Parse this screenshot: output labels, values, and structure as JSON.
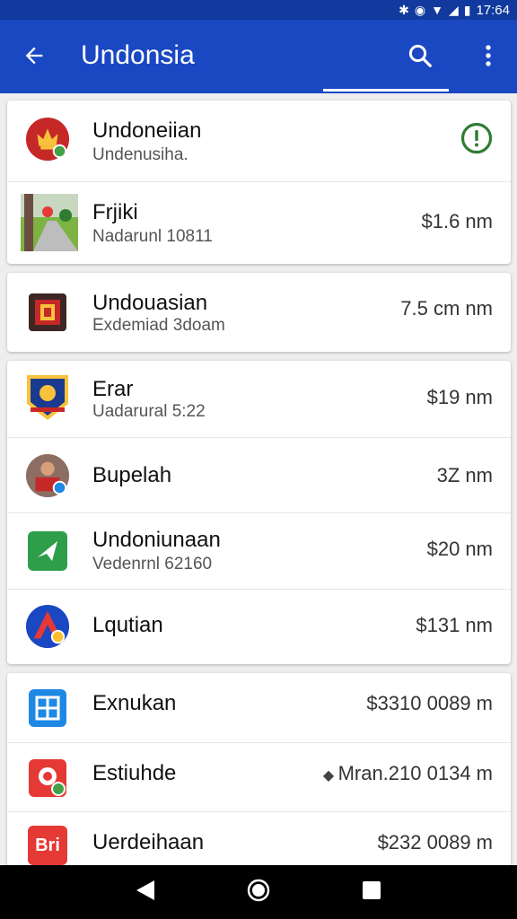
{
  "status_bar": {
    "time": "17:64",
    "colors": {
      "bg": "#123a9e"
    }
  },
  "app_bar": {
    "title": "Undonsia",
    "colors": {
      "bg": "#1a47c2"
    }
  },
  "card1": [
    {
      "name": "Undoneiian",
      "sub": "Undenusiha.",
      "amount": "",
      "icon": "emblem-icon",
      "status_icon": "alert-circle-icon"
    },
    {
      "name": "Frjiki",
      "sub": "Nadarunl 10811",
      "amount": "$1.6 nm",
      "icon": "photo-thumbnail-icon"
    }
  ],
  "card2": [
    {
      "name": "Undouasian",
      "sub": "Exdemiad 3doam",
      "amount": "7.5 cm nm",
      "icon": "crest-icon"
    }
  ],
  "card3": [
    {
      "name": "Erar",
      "sub": "Uadarural 5:22",
      "amount": "$19 nm",
      "icon": "badge-icon"
    },
    {
      "name": "Bupelah",
      "sub": "",
      "amount": "3Z nm",
      "icon": "avatar-icon"
    },
    {
      "name": "Undoniunaan",
      "sub": "Vedenrnl 62160",
      "amount": "$20 nm",
      "icon": "send-icon"
    },
    {
      "name": "Lqutian",
      "sub": "",
      "amount": "$131 nm",
      "icon": "a-logo-icon"
    }
  ],
  "card4": [
    {
      "name": "Exnukan",
      "sub": "",
      "amount": "$3310 0089 m",
      "icon": "grid-app-icon"
    },
    {
      "name": "Estiuhde",
      "sub": "",
      "amount": "Mran.210 0134 m",
      "icon": "map-pin-app-icon",
      "amount_icon": "diamond-icon"
    },
    {
      "name": "Uerdeihaan",
      "sub": "",
      "amount": "$232 0089 m",
      "icon": "bri-logo-icon",
      "icon_text": "Bri"
    }
  ]
}
